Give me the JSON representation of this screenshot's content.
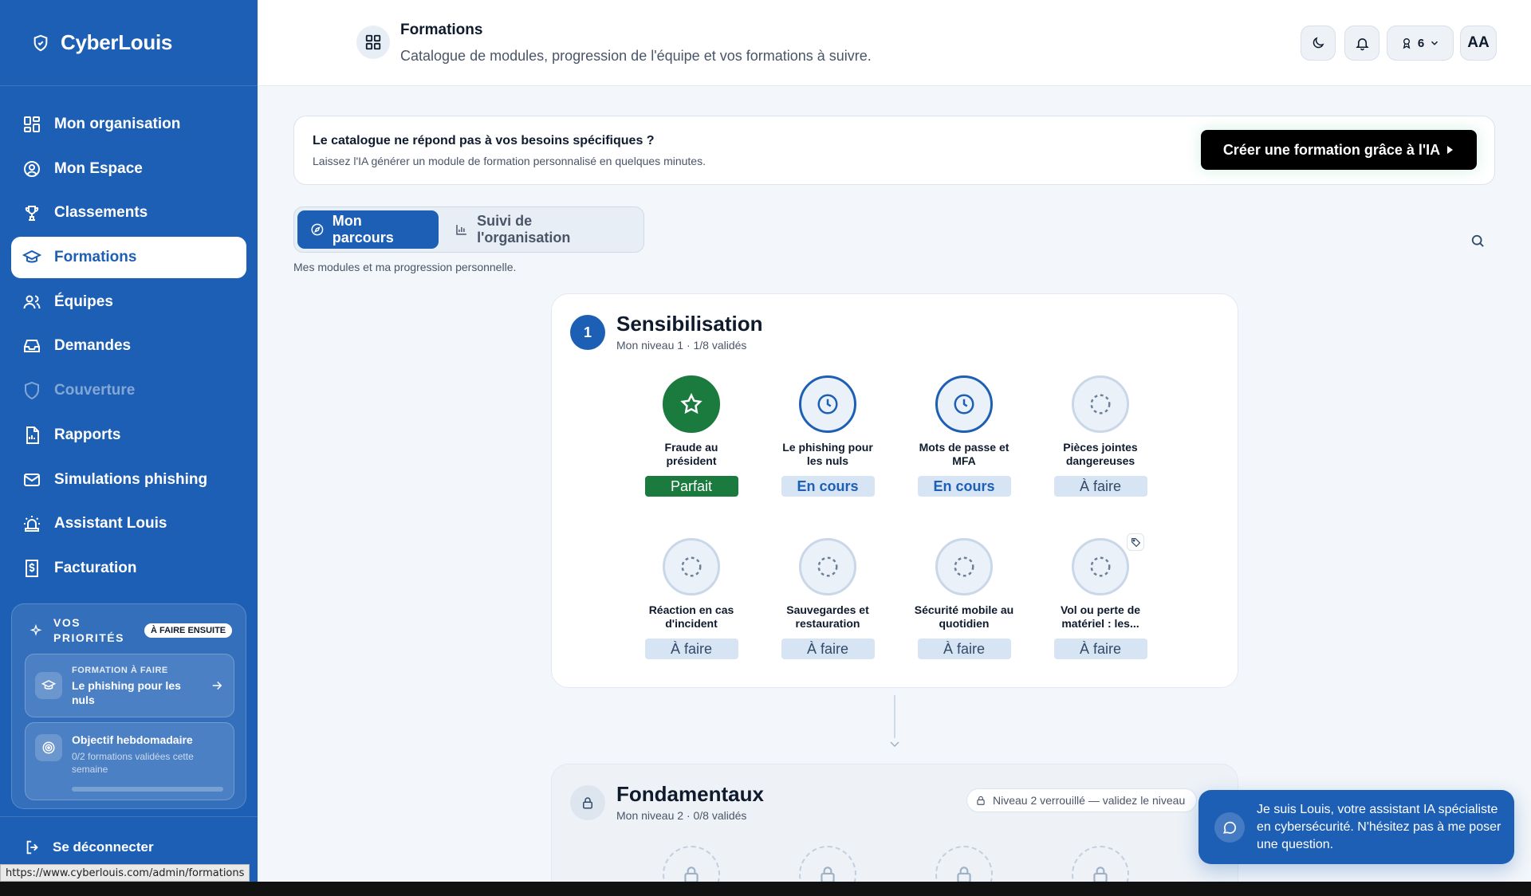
{
  "app": {
    "name": "CyberLouis"
  },
  "sidebar": {
    "items": [
      {
        "label": "Mon organisation",
        "icon": "grid-icon"
      },
      {
        "label": "Mon Espace",
        "icon": "user-circle-icon"
      },
      {
        "label": "Classements",
        "icon": "trophy-icon"
      },
      {
        "label": "Formations",
        "icon": "graduation-cap-icon",
        "active": true
      },
      {
        "label": "Équipes",
        "icon": "users-icon"
      },
      {
        "label": "Demandes",
        "icon": "inbox-icon"
      },
      {
        "label": "Couverture",
        "icon": "shield-icon",
        "disabled": true
      },
      {
        "label": "Rapports",
        "icon": "report-icon"
      },
      {
        "label": "Simulations phishing",
        "icon": "mail-icon"
      },
      {
        "label": "Assistant Louis",
        "icon": "siren-icon"
      },
      {
        "label": "Facturation",
        "icon": "billing-icon"
      }
    ],
    "priorities": {
      "title": "VOS PRIORITÉS",
      "badge": "À FAIRE ENSUITE",
      "todo": {
        "kicker": "FORMATION À FAIRE",
        "title": "Le phishing pour les nuls"
      },
      "weekly": {
        "title": "Objectif hebdomadaire",
        "subtitle": "0/2 formations validées cette semaine",
        "progress": 0
      }
    },
    "logout": "Se déconnecter"
  },
  "status_url": "https://www.cyberlouis.com/admin/formations",
  "header": {
    "title": "Formations",
    "subtitle": "Catalogue de modules, progression de l'équipe et vos formations à suivre.",
    "badge_count": "6",
    "avatar": "AA"
  },
  "banner": {
    "title": "Le catalogue ne répond pas à vos besoins spécifiques ?",
    "subtitle": "Laissez l'IA générer un module de formation personnalisé en quelques minutes.",
    "button": "Créer une formation grâce à l'IA"
  },
  "tabs": [
    {
      "label": "Mon parcours",
      "active": true
    },
    {
      "label": "Suivi de l'organisation"
    }
  ],
  "tabs_caption": "Mes modules et ma progression personnelle.",
  "levels": [
    {
      "number": "1",
      "title": "Sensibilisation",
      "subtitle": "Mon niveau 1 · 1/8 validés",
      "modules": [
        {
          "name": "Fraude au président",
          "status": "Parfait",
          "state": "done"
        },
        {
          "name": "Le phishing pour les nuls",
          "status": "En cours",
          "state": "progress"
        },
        {
          "name": "Mots de passe et MFA",
          "status": "En cours",
          "state": "progress"
        },
        {
          "name": "Pièces jointes dangereuses",
          "status": "À faire",
          "state": "todo"
        },
        {
          "name": "Réaction en cas d'incident",
          "status": "À faire",
          "state": "todo"
        },
        {
          "name": "Sauvegardes et restauration",
          "status": "À faire",
          "state": "todo"
        },
        {
          "name": "Sécurité mobile au quotidien",
          "status": "À faire",
          "state": "todo"
        },
        {
          "name": "Vol ou perte de matériel : les...",
          "status": "À faire",
          "state": "todo",
          "tag": true
        }
      ]
    },
    {
      "title": "Fondamentaux",
      "subtitle": "Mon niveau 2 · 0/8 validés",
      "lock_note": "Niveau 2 verrouillé — validez le niveau"
    }
  ],
  "chat": {
    "message": "Je suis Louis, votre assistant IA spécialiste en cybersécurité. N'hésitez pas à me poser une question."
  },
  "colors": {
    "primary": "#1d5fb5",
    "success": "#1b7a3e",
    "dark": "#000000"
  }
}
